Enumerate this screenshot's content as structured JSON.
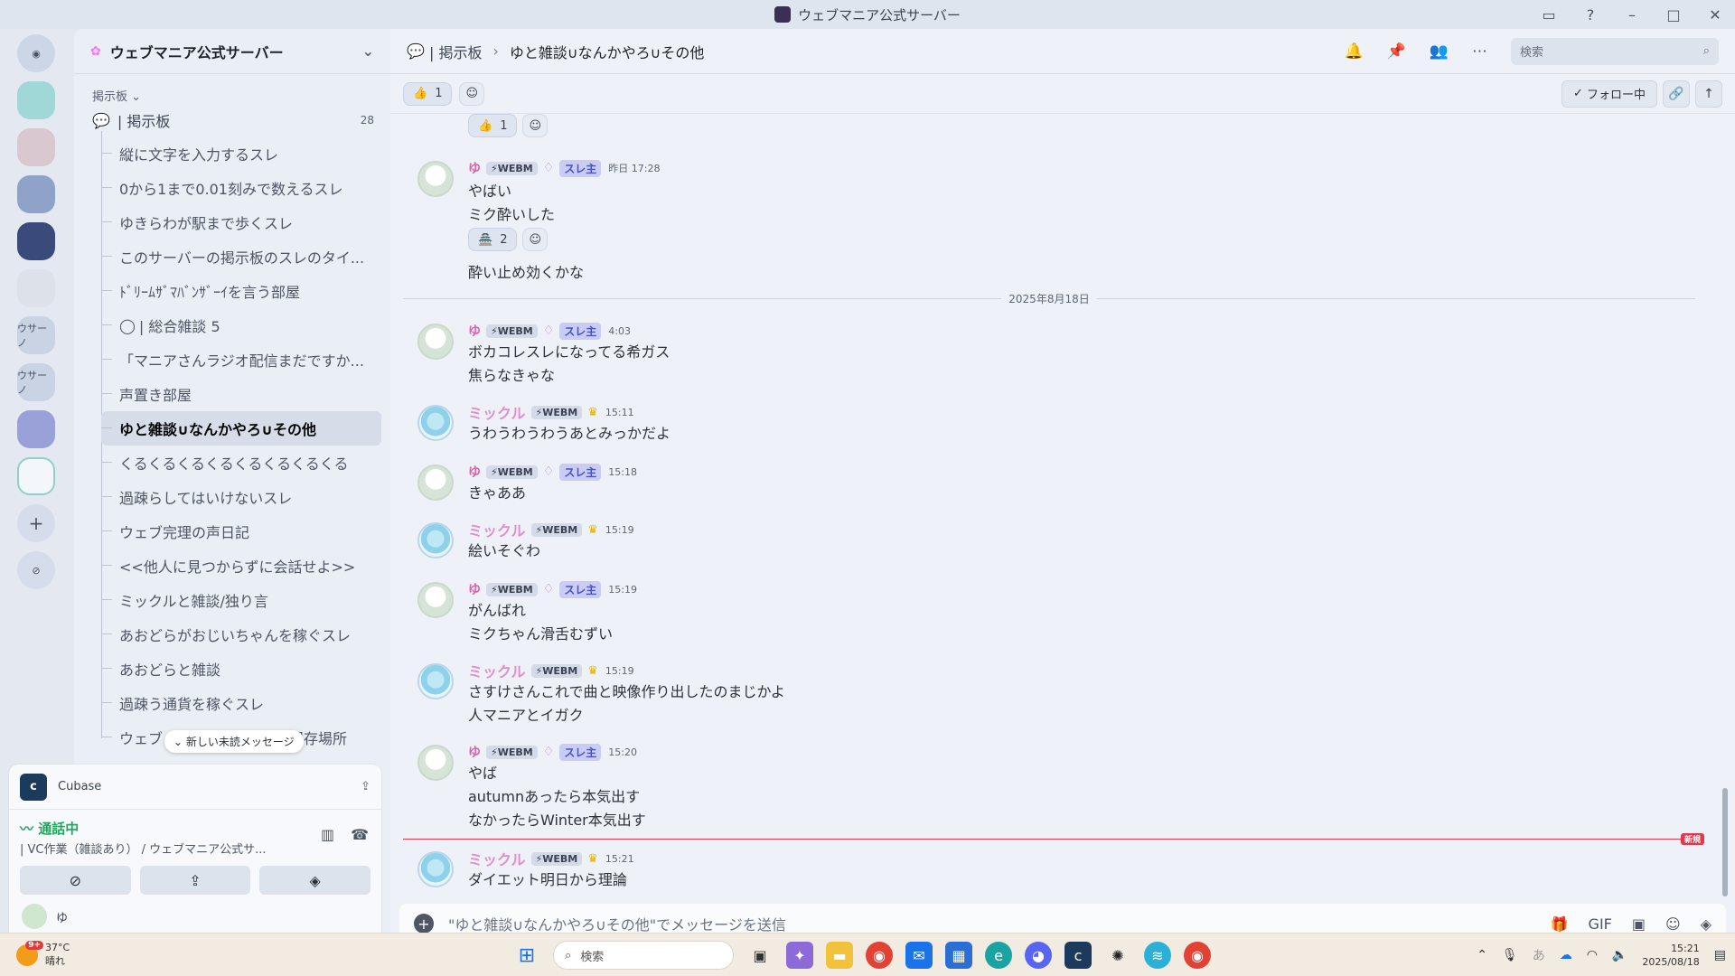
{
  "window": {
    "title": "ウェブマニア公式サーバー"
  },
  "rail": {
    "labels": [
      "ウサーノ",
      "ウサーノ"
    ]
  },
  "sidebar": {
    "server_name": "ウェブマニア公式サーバー",
    "category": "掲示板",
    "forum": {
      "name": "| 掲示板",
      "count": "28"
    },
    "threads": [
      "縦に文字を入力するスレ",
      "0から1まで0.01刻みで数えるスレ",
      "ゆきらわが駅まで歩くスレ",
      "このサーバーの掲示板のスレのタイ...",
      "ﾄﾞﾘｰﾑｻﾞﾏﾊﾞﾝｻﾞｰｲを言う部屋",
      "| 総合雑談 5",
      "「マニアさんラジオ配信まだですか...",
      "声置き部屋",
      "ゆと雑談∪なんかやろ∪その他",
      "くるくるくるくるくるくるくるくる",
      "過疎らしてはいけないスレ",
      "ウェブ完理の声日記",
      "<<他人に見つからずに会話せよ>>",
      "ミックルと雑談/独り言",
      "あおどらがおじいちゃんを稼ぐスレ",
      "あおどらと雑談",
      "過疎う通貨を稼ぐスレ",
      "ウェブ",
      "保存場所"
    ],
    "unread_pill": "新しい未読メッセージ"
  },
  "panel": {
    "activity": "Cubase",
    "voice_status": "通話中",
    "voice_location": "| VC作業（雑談あり） / ウェブマニア公式サ...",
    "user_name": "ゆ"
  },
  "header": {
    "forum": "| 掲示板",
    "thread": "ゆと雑談∪なんかやろ∪その他",
    "search_placeholder": "検索"
  },
  "toolbar": {
    "reaction_count": "1",
    "follow_label": "フォロー中"
  },
  "chat": {
    "prev_reaction_count": "1",
    "date_divider": "2025年8月18日",
    "new_label": "新規",
    "tag": "WEBM",
    "op": "スレ主",
    "messages": [
      {
        "author": "ゆ",
        "time": "昨日 17:28",
        "lines": [
          "やばい",
          "ミク酔いした"
        ],
        "reaction": "2",
        "after": "酔い止め効くかな"
      },
      {
        "author": "ゆ",
        "time": "4:03",
        "lines": [
          "ボカコレスレになってる希ガス",
          "焦らなきゃな"
        ]
      },
      {
        "author": "ミックル",
        "time": "15:11",
        "lines": [
          "うわうわうわうあとみっかだよ"
        ]
      },
      {
        "author": "ゆ",
        "time": "15:18",
        "lines": [
          "きゃああ"
        ]
      },
      {
        "author": "ミックル",
        "time": "15:19",
        "lines": [
          "絵いそぐわ"
        ]
      },
      {
        "author": "ゆ",
        "time": "15:19",
        "lines": [
          "がんばれ",
          "ミクちゃん滑舌むずい"
        ]
      },
      {
        "author": "ミックル",
        "time": "15:19",
        "lines": [
          "さすけさんこれで曲と映像作り出したのまじかよ",
          "人マニアとイガク"
        ]
      },
      {
        "author": "ゆ",
        "time": "15:20",
        "lines": [
          "やば",
          "autumnあったら本気出す",
          "なかったらWinter本気出す"
        ]
      },
      {
        "author": "ミックル",
        "time": "15:21",
        "lines": [
          "ダイエット明日から理論"
        ]
      }
    ]
  },
  "composer": {
    "placeholder": "\"ゆと雑談∪なんかやろ∪その他\"でメッセージを送信"
  },
  "taskbar": {
    "temp": "37°C",
    "weather": "晴れ",
    "weather_badge": "9+",
    "search": "検索",
    "time": "15:21",
    "date": "2025/08/18"
  },
  "colors": {
    "accent": "#5865f2",
    "online": "#23a55a",
    "new": "#e0394a"
  }
}
